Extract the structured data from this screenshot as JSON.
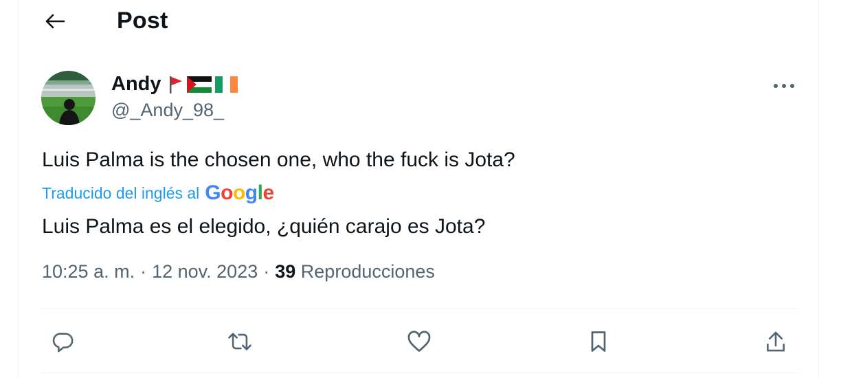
{
  "header": {
    "title": "Post",
    "back_icon": "arrow-left-icon"
  },
  "tweet": {
    "author": {
      "name": "Andy",
      "handle": "@_Andy_98_",
      "flags": [
        "red-flag-icon",
        "palestine-flag-icon",
        "ireland-flag-icon"
      ]
    },
    "original_text": "Luis Palma is the chosen one, who the fuck is Jota?",
    "translation_label": "Traducido del inglés al",
    "translation_brand": "Google",
    "translated_text": "Luis Palma es el elegido, ¿quién carajo es Jota?",
    "time": "10:25 a. m.",
    "date": "12 nov. 2023",
    "views_count": "39",
    "views_label": "Reproducciones"
  },
  "actions": [
    "reply-icon",
    "repost-icon",
    "like-icon",
    "bookmark-icon",
    "share-icon"
  ],
  "colors": {
    "accent": "#1d9bf0",
    "text": "#0f1419",
    "secondary": "#536471",
    "border": "#eff3f4"
  }
}
